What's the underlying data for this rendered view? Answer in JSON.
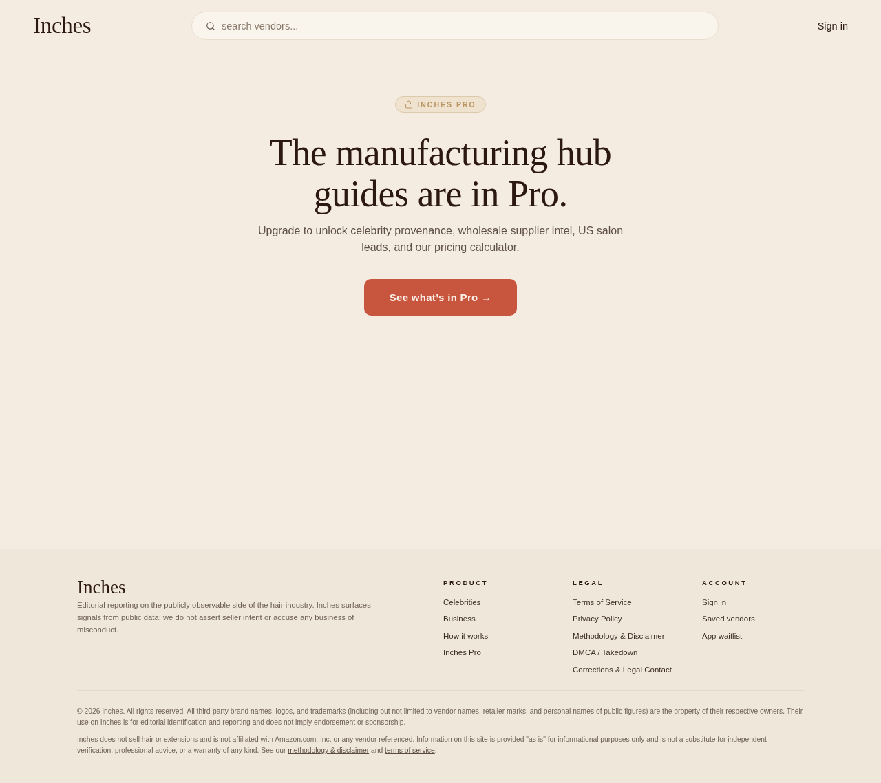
{
  "header": {
    "logo": "Inches",
    "search": {
      "placeholder": "search vendors..."
    },
    "sign_in": "Sign in"
  },
  "hero": {
    "badge": "INCHES PRO",
    "headline": [
      "The manufacturing hub",
      "guides are in Pro."
    ],
    "subtitle": "Upgrade to unlock celebrity provenance, wholesale supplier intel, US salon leads, and our pricing calculator.",
    "cta": "See what’s in Pro →"
  },
  "footer": {
    "brand": "Inches",
    "tagline": "Editorial reporting on the publicly observable side of the hair industry. Inches surfaces signals from public data; we do not assert seller intent or accuse any business of misconduct.",
    "columns": [
      {
        "heading": "PRODUCT",
        "links": [
          "Celebrities",
          "Business",
          "How it works",
          "Inches Pro"
        ]
      },
      {
        "heading": "LEGAL",
        "links": [
          "Terms of Service",
          "Privacy Policy",
          "Methodology & Disclaimer",
          "DMCA / Takedown",
          "Corrections & Legal Contact"
        ]
      },
      {
        "heading": "ACCOUNT",
        "links": [
          "Sign in",
          "Saved vendors",
          "App waitlist"
        ]
      }
    ],
    "copyright": "© 2026 Inches. All rights reserved. All third-party brand names, logos, and trademarks (including but not limited to vendor names, retailer marks, and personal names of public figures) are the property of their respective owners. Their use on Inches is for editorial identification and reporting and does not imply endorsement or sponsorship.",
    "disclaimer": {
      "text": "Inches does not sell hair or extensions and is not affiliated with Amazon.com, Inc. or any vendor referenced. Information on this site is provided \"as is\" for informational purposes only and is not a substitute for independent verification, professional advice, or a warranty of any kind. See our",
      "link_1": "methodology & disclaimer",
      "joiner": "and",
      "link_2": "terms of service",
      "end": "."
    }
  }
}
